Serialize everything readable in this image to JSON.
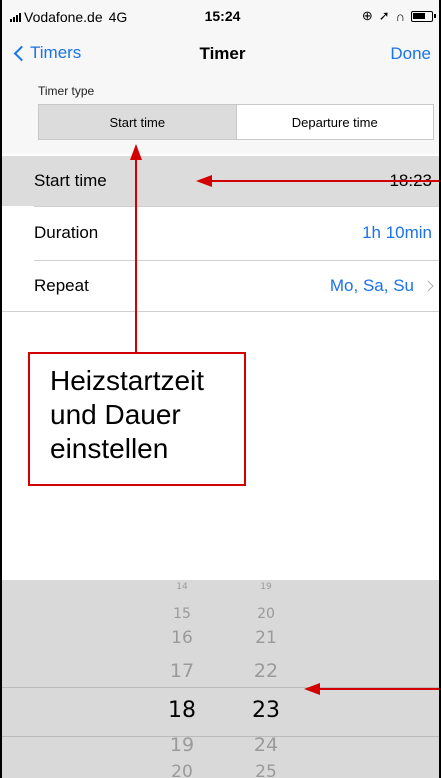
{
  "status_bar": {
    "carrier": "Vodafone.de",
    "network": "4G",
    "time": "15:24"
  },
  "nav": {
    "back_label": "Timers",
    "title": "Timer",
    "done_label": "Done"
  },
  "timer_type": {
    "label": "Timer type",
    "options": [
      "Start time",
      "Departure time"
    ],
    "selected": "Start time"
  },
  "rows": {
    "start_time": {
      "label": "Start time",
      "value": "18:23"
    },
    "duration": {
      "label": "Duration",
      "value": "1h 10min"
    },
    "repeat": {
      "label": "Repeat",
      "value": "Mo, Sa, Su"
    }
  },
  "annotation": {
    "line1": "Heizstartzeit",
    "line2": "und Dauer",
    "line3": "einstellen",
    "color": "#d30000"
  },
  "picker": {
    "hours": [
      "14",
      "15",
      "16",
      "17",
      "18",
      "19",
      "20"
    ],
    "minutes": [
      "19",
      "20",
      "21",
      "22",
      "23",
      "24",
      "25"
    ],
    "selected_hour": "18",
    "selected_minute": "23"
  },
  "colors": {
    "accent": "#1a73e8",
    "highlight_row": "#dcdcdc",
    "picker_bg": "#d9d9d9"
  },
  "icons": [
    "signal-icon",
    "battery-icon",
    "back-chevron-icon",
    "chevron-right-icon"
  ]
}
